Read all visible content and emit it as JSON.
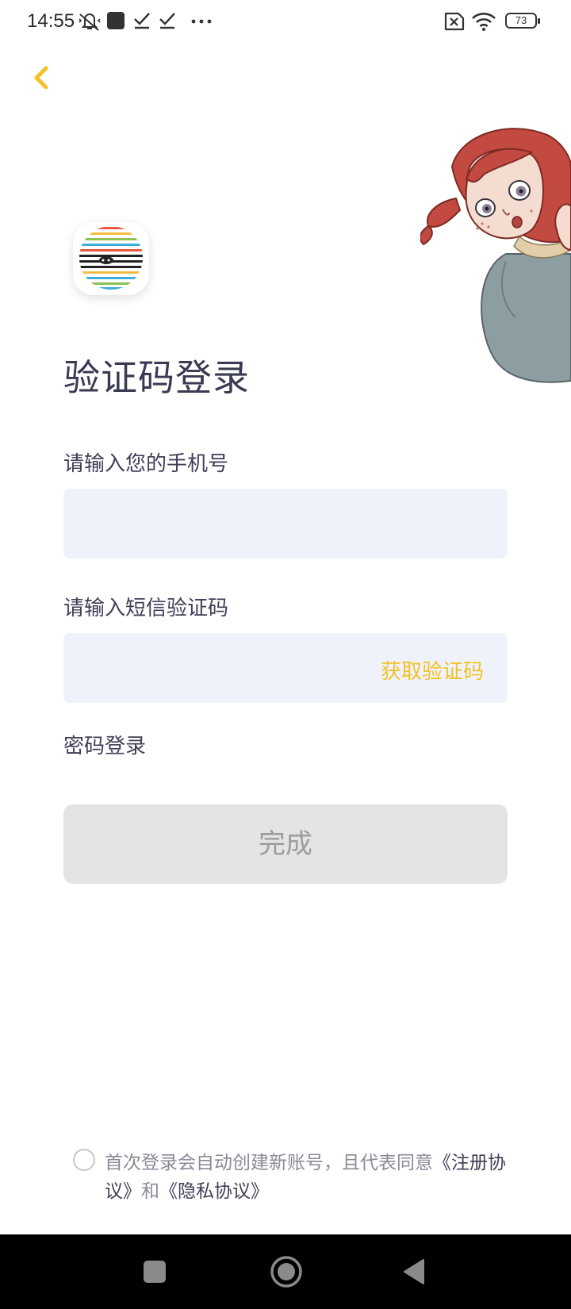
{
  "status_bar": {
    "time": "14:55",
    "battery": "73",
    "icons": [
      "mute-vibrate-icon",
      "app-square-icon",
      "check-icon",
      "check-icon",
      "more-dots-icon",
      "no-sim-icon",
      "wifi-icon",
      "battery-icon"
    ]
  },
  "header": {
    "back_icon": "chevron-left-icon"
  },
  "login": {
    "title": "验证码登录",
    "phone_label": "请输入您的手机号",
    "phone_value": "",
    "code_label": "请输入短信验证码",
    "code_value": "",
    "get_code": "获取验证码",
    "password_login": "密码登录",
    "submit": "完成"
  },
  "agreement": {
    "text_prefix": "首次登录会自动创建新账号，且代表同意",
    "register_link": "《注册协议》",
    "and": "和",
    "privacy_link": "《隐私协议》"
  },
  "colors": {
    "accent": "#f3c227",
    "input_bg": "#eff2fa",
    "button_disabled": "#e4e4e4",
    "text": "#3f3f58"
  },
  "nav_bar": {
    "items": [
      "recents-square-icon",
      "home-circle-icon",
      "back-triangle-icon"
    ]
  }
}
